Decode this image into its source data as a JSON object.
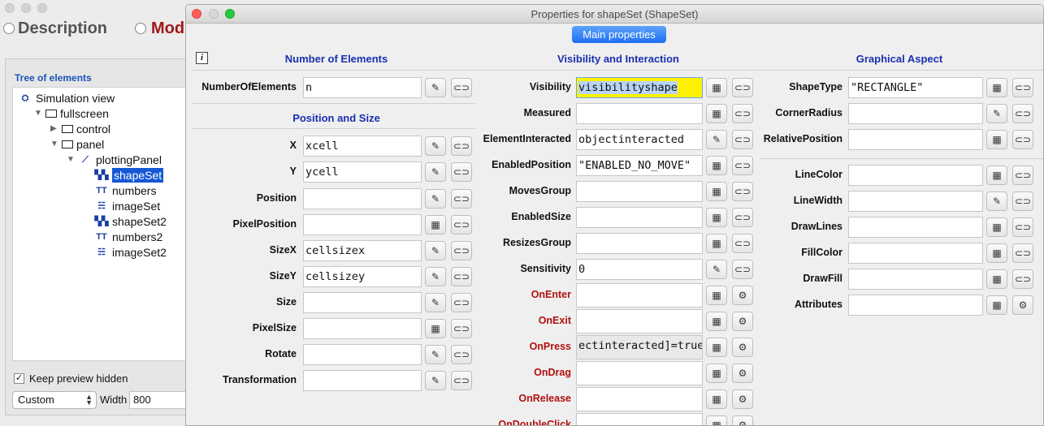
{
  "background": {
    "tabs": [
      "Description",
      "Mod"
    ],
    "tree_title": "Tree of elements",
    "tree": [
      {
        "label": "Simulation view",
        "indent": 0,
        "icon": "simulation-view-icon",
        "expander": ""
      },
      {
        "label": "fullscreen",
        "indent": 1,
        "icon": "frame-icon",
        "expander": "▼"
      },
      {
        "label": "control",
        "indent": 2,
        "icon": "panel-icon",
        "expander": "▶"
      },
      {
        "label": "panel",
        "indent": 2,
        "icon": "panel-icon",
        "expander": "▼"
      },
      {
        "label": "plottingPanel",
        "indent": 3,
        "icon": "plotting-panel-icon",
        "expander": "▼"
      },
      {
        "label": "shapeSet",
        "indent": 4,
        "icon": "shape-set-icon",
        "expander": "",
        "selected": true
      },
      {
        "label": "numbers",
        "indent": 4,
        "icon": "text-set-icon",
        "expander": ""
      },
      {
        "label": "imageSet",
        "indent": 4,
        "icon": "image-set-icon",
        "expander": ""
      },
      {
        "label": "shapeSet2",
        "indent": 4,
        "icon": "shape-set-icon",
        "expander": ""
      },
      {
        "label": "numbers2",
        "indent": 4,
        "icon": "text-set-icon",
        "expander": ""
      },
      {
        "label": "imageSet2",
        "indent": 4,
        "icon": "image-set-icon",
        "expander": ""
      }
    ],
    "keep_preview": "Keep preview hidden",
    "keep_preview_checked": "✓",
    "size_select": "Custom",
    "width_label": "Width",
    "width_value": "800"
  },
  "window": {
    "title": "Properties for shapeSet (ShapeSet)",
    "main_button": "Main properties",
    "info_icon": "i",
    "sections": {
      "number": "Number of Elements",
      "position": "Position and Size",
      "visibility": "Visibility and Interaction",
      "graphical": "Graphical Aspect"
    },
    "col1": [
      {
        "label": "NumberOfElements",
        "value": "n",
        "btn": "edit"
      },
      {
        "label": "X",
        "value": "xcell",
        "btn": "edit"
      },
      {
        "label": "Y",
        "value": "ycell",
        "btn": "edit"
      },
      {
        "label": "Position",
        "value": "",
        "btn": "edit"
      },
      {
        "label": "PixelPosition",
        "value": "",
        "btn": "dialog"
      },
      {
        "label": "SizeX",
        "value": "cellsizex",
        "btn": "edit"
      },
      {
        "label": "SizeY",
        "value": "cellsizey",
        "btn": "edit"
      },
      {
        "label": "Size",
        "value": "",
        "btn": "edit"
      },
      {
        "label": "PixelSize",
        "value": "",
        "btn": "dialog"
      },
      {
        "label": "Rotate",
        "value": "",
        "btn": "edit"
      },
      {
        "label": "Transformation",
        "value": "",
        "btn": "edit"
      }
    ],
    "col2": [
      {
        "label": "Visibility",
        "value": "visibilityshape",
        "btn": "dialog",
        "red": false
      },
      {
        "label": "Measured",
        "value": "",
        "btn": "dialog",
        "red": false
      },
      {
        "label": "ElementInteracted",
        "value": "objectinteracted",
        "btn": "edit",
        "red": false
      },
      {
        "label": "EnabledPosition",
        "value": "\"ENABLED_NO_MOVE\"",
        "btn": "dialog",
        "red": false
      },
      {
        "label": "MovesGroup",
        "value": "",
        "btn": "dialog",
        "red": false
      },
      {
        "label": "EnabledSize",
        "value": "",
        "btn": "dialog",
        "red": false
      },
      {
        "label": "ResizesGroup",
        "value": "",
        "btn": "dialog",
        "red": false
      },
      {
        "label": "Sensitivity",
        "value": "0",
        "btn": "edit",
        "red": false
      },
      {
        "label": "OnEnter",
        "value": "",
        "btn": "dialog",
        "red": true
      },
      {
        "label": "OnExit",
        "value": "",
        "btn": "dialog",
        "red": true
      },
      {
        "label": "OnPress",
        "value": "ectinteracted]=true;",
        "btn": "dialog",
        "red": true
      },
      {
        "label": "OnDrag",
        "value": "",
        "btn": "dialog",
        "red": true
      },
      {
        "label": "OnRelease",
        "value": "",
        "btn": "dialog",
        "red": true
      },
      {
        "label": "OnDoubleClick",
        "value": "",
        "btn": "dialog",
        "red": true
      }
    ],
    "col3": [
      {
        "label": "ShapeType",
        "value": "\"RECTANGLE\"",
        "btn": "dialog"
      },
      {
        "label": "CornerRadius",
        "value": "",
        "btn": "edit"
      },
      {
        "label": "RelativePosition",
        "value": "",
        "btn": "dialog"
      },
      {
        "label": "LineColor",
        "value": "",
        "btn": "dialog"
      },
      {
        "label": "LineWidth",
        "value": "",
        "btn": "edit"
      },
      {
        "label": "DrawLines",
        "value": "",
        "btn": "dialog"
      },
      {
        "label": "FillColor",
        "value": "",
        "btn": "dialog"
      },
      {
        "label": "DrawFill",
        "value": "",
        "btn": "dialog"
      },
      {
        "label": "Attributes",
        "value": "",
        "btn": "dialog"
      }
    ]
  },
  "colors": {
    "section_header": "#1a2fb0",
    "action_label": "#b01010",
    "selection": "#1558d6",
    "highlight": "#fff200"
  }
}
